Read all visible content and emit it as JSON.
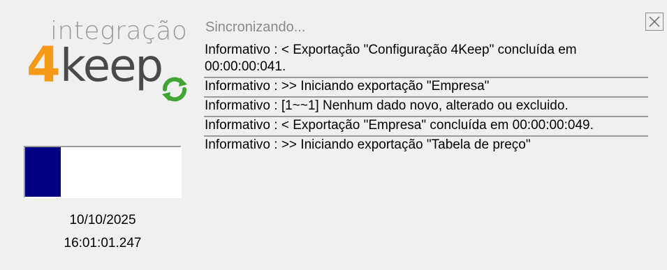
{
  "window": {
    "title": "Sincronizando...",
    "close_icon": "close-icon"
  },
  "logo": {
    "top_text": "integração",
    "number": "4",
    "brand": "keep",
    "brand_color": "#f59a18",
    "sync_icon": "sync-arrows-icon"
  },
  "progress": {
    "fill_fraction": 0.23,
    "fill_color": "#000080"
  },
  "status": {
    "date": "10/10/2025",
    "time": "16:01:01.247"
  },
  "log": [
    {
      "text": "Informativo  :  < Exportação \"Configuração 4Keep\" concluída em 00:00:00:041."
    },
    {
      "text": "Informativo  : >> Iniciando exportação \"Empresa\""
    },
    {
      "text": "Informativo  :    [1~~1]  Nenhum dado novo, alterado ou excluido."
    },
    {
      "text": "Informativo  :  < Exportação \"Empresa\" concluída em 00:00:00:049."
    },
    {
      "text": "Informativo  : >> Iniciando exportação \"Tabela de preço\""
    }
  ]
}
